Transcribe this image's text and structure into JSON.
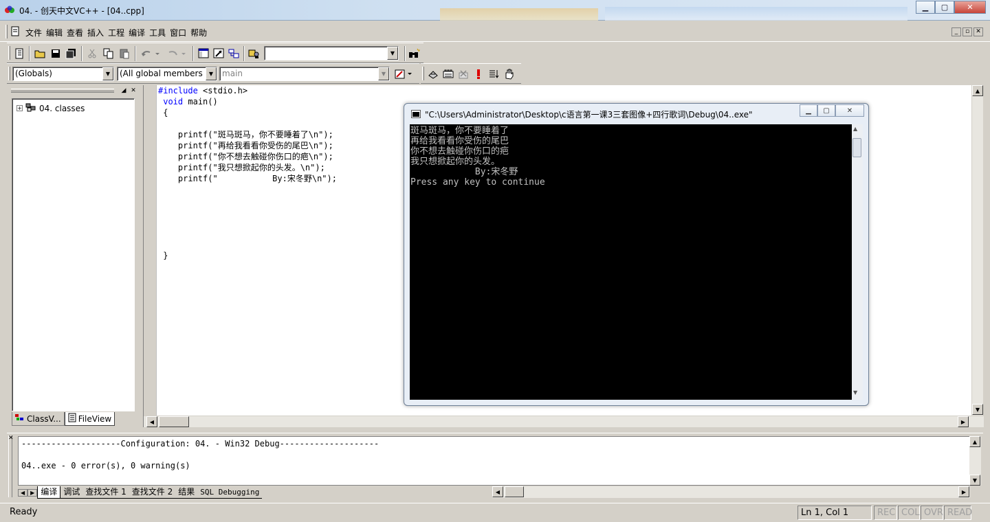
{
  "window": {
    "title": "04. - 创天中文VC++ - [04..cpp]",
    "buttons": {
      "minimize": "▁",
      "maximize": "▢",
      "close": "✕"
    }
  },
  "menu": {
    "items": [
      "文件",
      "编辑",
      "查看",
      "插入",
      "工程",
      "编译",
      "工具",
      "窗口",
      "帮助"
    ]
  },
  "toolbar": {
    "find_combo_value": ""
  },
  "wizard_bar": {
    "scope": "(Globals)",
    "members": "(All global members",
    "function": "main"
  },
  "workspace": {
    "tree_root": "04. classes",
    "tab_classview": "ClassV...",
    "tab_fileview": "FileView"
  },
  "editor": {
    "lines": [
      "#include <stdio.h>",
      " void main()",
      " {",
      "",
      "    printf(\"斑马斑马，你不要睡着了\\n\");",
      "    printf(\"再给我看看你受伤的尾巴\\n\");",
      "    printf(\"你不想去触碰你伤口的疤\\n\");",
      "    printf(\"我只想掀起你的头发。\\n\");",
      "    printf(\"           By:宋冬野\\n\");",
      "",
      "",
      "",
      "",
      "",
      "",
      " }"
    ]
  },
  "console": {
    "title": "\"C:\\Users\\Administrator\\Desktop\\c语言第一课3三套图像+四行歌词\\Debug\\04..exe\"",
    "output_lines": [
      "斑马斑马，你不要睡着了",
      "再给我看看你受伤的尾巴",
      "你不想去触碰你伤口的疤",
      "我只想掀起你的头发。",
      "            By:宋冬野",
      "Press any key to continue"
    ]
  },
  "output": {
    "lines": [
      "--------------------Configuration: 04. - Win32 Debug--------------------",
      "",
      "04..exe - 0 error(s), 0 warning(s)"
    ],
    "tabs": [
      "编译",
      "调试",
      "查找文件 1",
      "查找文件 2",
      "结果",
      "SQL Debugging"
    ]
  },
  "status": {
    "message": "Ready",
    "position": "Ln 1, Col 1",
    "rec": "REC",
    "col": "COL",
    "ovr": "OVR",
    "read": "READ"
  }
}
